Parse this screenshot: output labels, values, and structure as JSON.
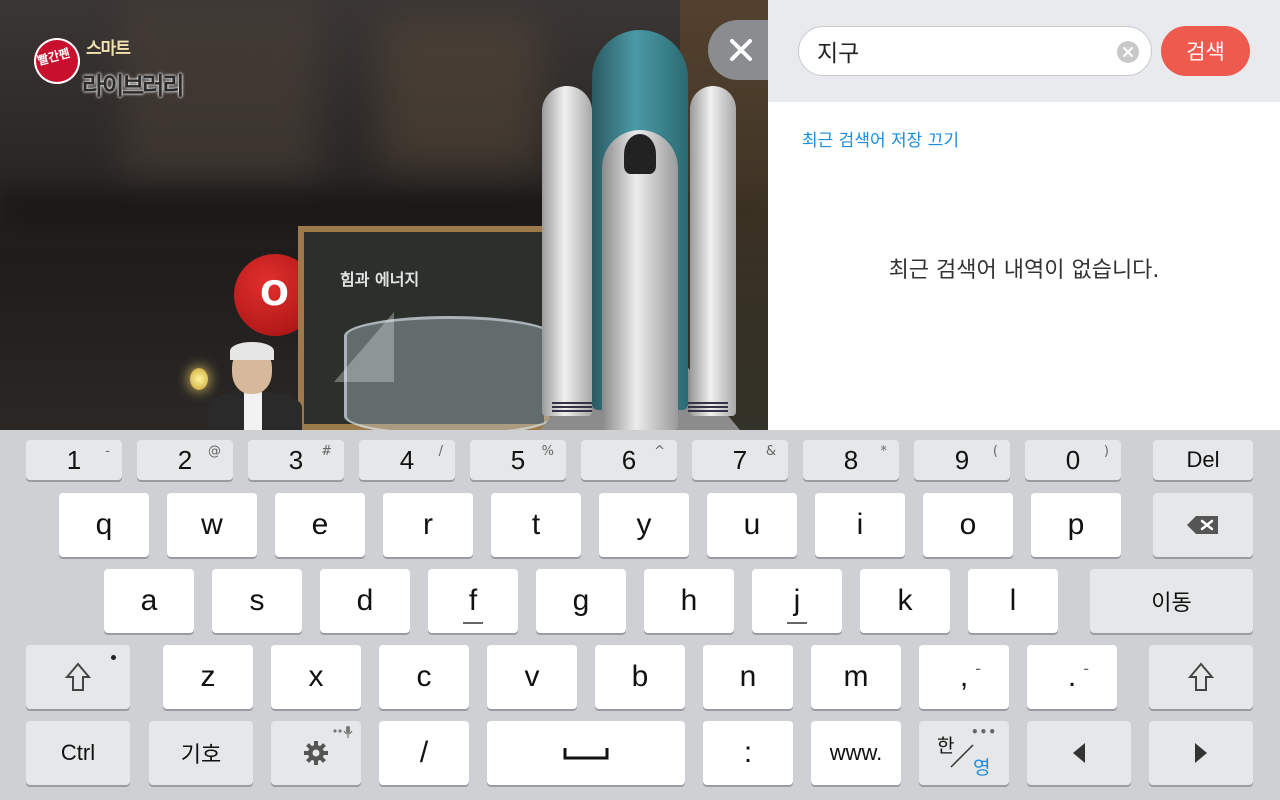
{
  "logo": {
    "badge": "빨간펜",
    "line1": "스마트",
    "line2": "라이브러리"
  },
  "scene": {
    "board_title": "힘과 에너지",
    "ball_letter": "O"
  },
  "search": {
    "query": "지구",
    "submit_label": "검색"
  },
  "recent": {
    "toggle_label": "최근 검색어 저장 끄기",
    "empty_message": "최근 검색어 내역이 없습니다."
  },
  "keyboard": {
    "number_row": [
      {
        "main": "1",
        "sub": "-"
      },
      {
        "main": "2",
        "sub": "@"
      },
      {
        "main": "3",
        "sub": "#"
      },
      {
        "main": "4",
        "sub": "/"
      },
      {
        "main": "5",
        "sub": "%"
      },
      {
        "main": "6",
        "sub": "^"
      },
      {
        "main": "7",
        "sub": "&"
      },
      {
        "main": "8",
        "sub": "*"
      },
      {
        "main": "9",
        "sub": "("
      },
      {
        "main": "0",
        "sub": ")"
      }
    ],
    "del_label": "Del",
    "row1": [
      "q",
      "w",
      "e",
      "r",
      "t",
      "y",
      "u",
      "i",
      "o",
      "p"
    ],
    "row2": [
      "a",
      "s",
      "d",
      "f",
      "g",
      "h",
      "j",
      "k",
      "l"
    ],
    "move_label": "이동",
    "row3": [
      "z",
      "x",
      "c",
      "v",
      "b",
      "n",
      "m"
    ],
    "comma": ",",
    "comma_sub": "-",
    "period": ".",
    "period_sub": "-",
    "ctrl_label": "Ctrl",
    "symbol_label": "기호",
    "slash": "/",
    "colon": ":",
    "www_label": "www.",
    "lang_primary": "한",
    "lang_secondary": "영"
  },
  "colors": {
    "accent": "#ef5a4e",
    "link": "#1b8de0",
    "search_bar_bg": "#e8eaee",
    "keyboard_bg": "#cfd0d4"
  }
}
